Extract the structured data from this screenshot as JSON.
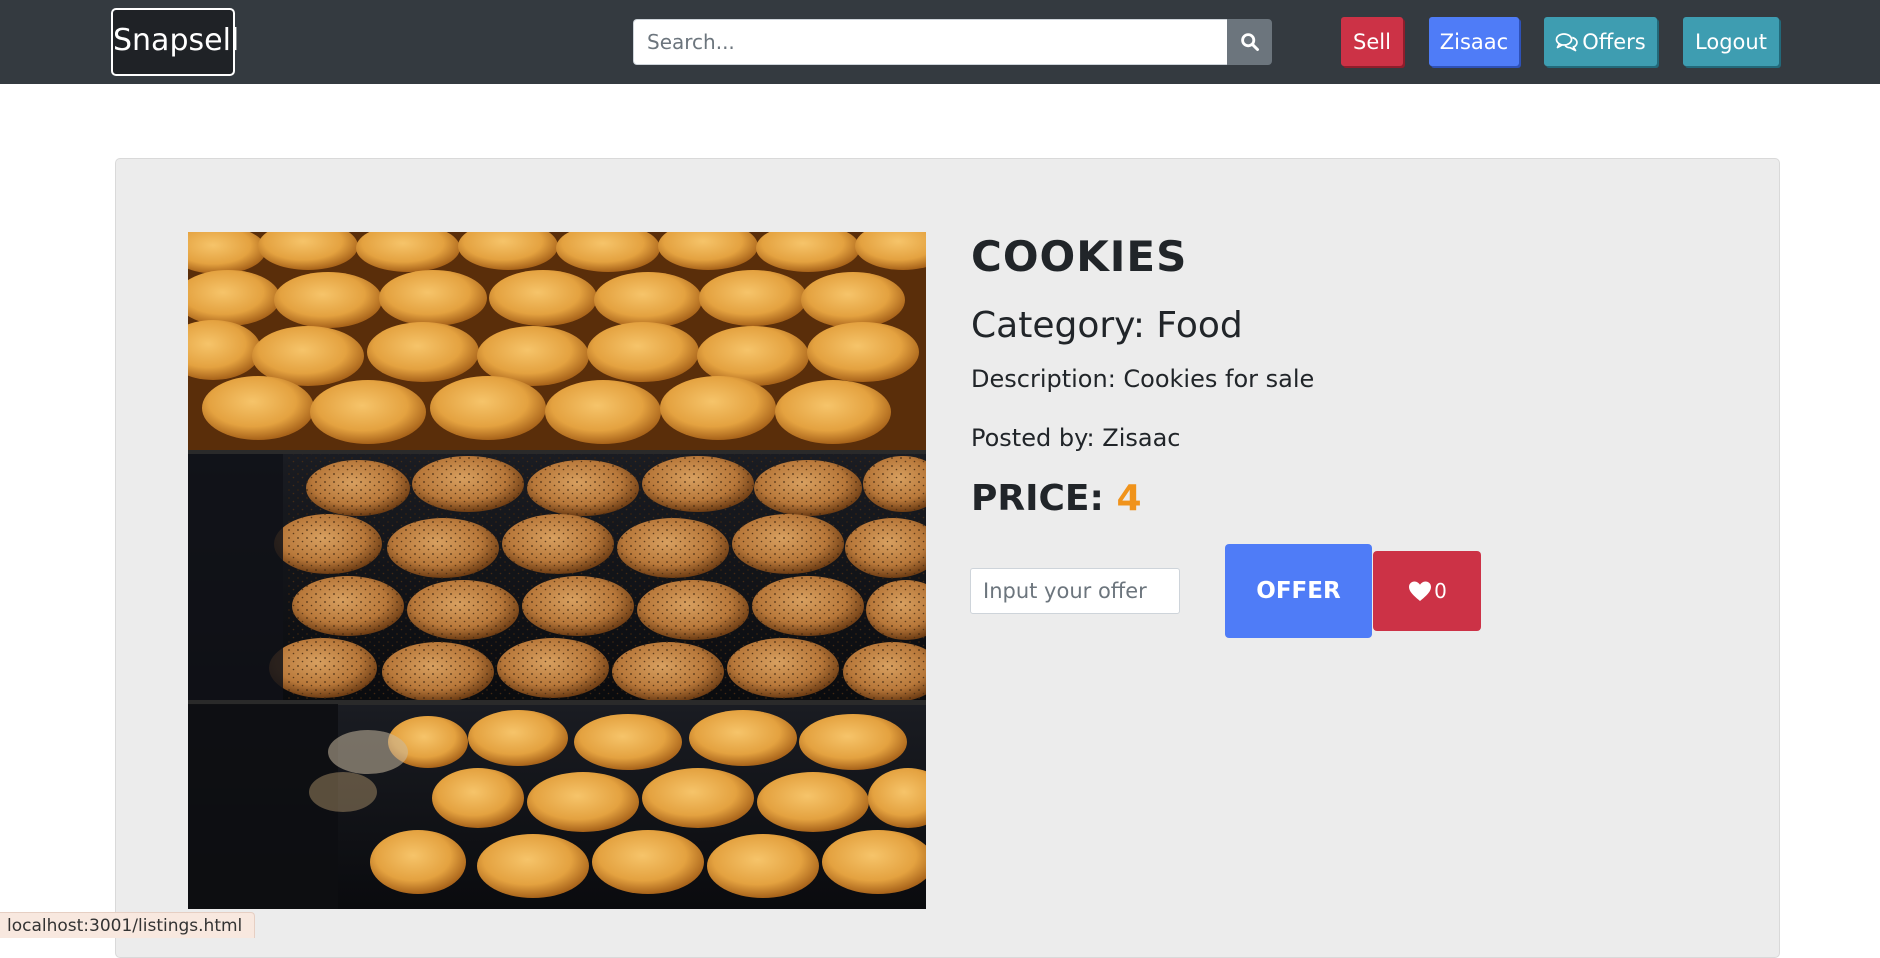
{
  "navbar": {
    "brand": "Snapsell",
    "search": {
      "placeholder": "Search...",
      "value": ""
    },
    "sell_label": "Sell",
    "user_label": "Zisaac",
    "offers_label": "Offers",
    "logout_label": "Logout"
  },
  "listing": {
    "title": "COOKIES",
    "category_prefix": "Category: ",
    "category": "Food",
    "description_prefix": "Description: ",
    "description": "Cookies for sale",
    "posted_prefix": "Posted by: ",
    "posted_by": "Zisaac",
    "price_prefix": "PRICE: ",
    "price": "4",
    "offer_placeholder": "Input your offer",
    "offer_button": "OFFER",
    "likes": "0"
  },
  "status_bar": {
    "url": "localhost:3001/listings.html"
  },
  "colors": {
    "navbar_bg": "#343a40",
    "sell": "#cc3246",
    "user": "#4f7cf7",
    "offers": "#3e9db1",
    "logout": "#3e9db1",
    "price_value": "#f0931b",
    "card_bg": "#ececec"
  },
  "icons": {
    "search": "search-icon",
    "offers": "chat-icon",
    "likes": "heart-icon"
  }
}
